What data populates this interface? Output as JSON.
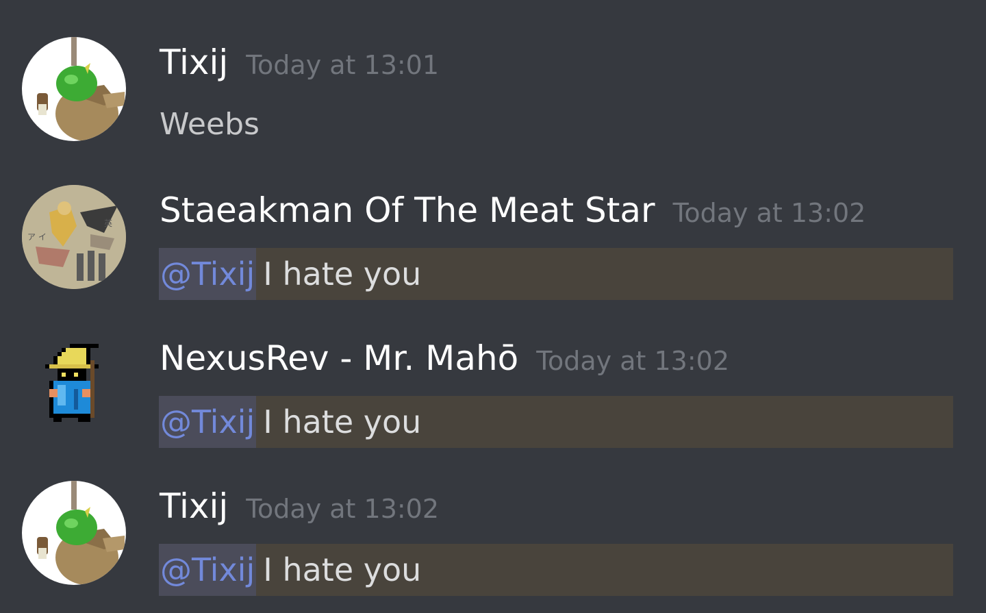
{
  "messages": [
    {
      "author": "Tixij",
      "timestamp": "Today at 13:01",
      "text": "Weebs",
      "avatar_icon": "moogle-avatar-icon"
    },
    {
      "author": "Staeakman Of The Meat Star",
      "timestamp": "Today at 13:02",
      "mention": "@Tixij",
      "text": "I hate you",
      "avatar_icon": "woodblock-print-avatar-icon"
    },
    {
      "author": "NexusRev - Mr. Mahō",
      "timestamp": "Today at 13:02",
      "mention": "@Tixij",
      "text": "I hate you",
      "avatar_icon": "black-mage-avatar-icon"
    },
    {
      "author": "Tixij",
      "timestamp": "Today at 13:02",
      "mention": "@Tixij",
      "text": "I hate you",
      "avatar_icon": "moogle-avatar-icon"
    }
  ],
  "colors": {
    "background": "#36393f",
    "username": "#ffffff",
    "timestamp": "#72767d",
    "mention_text": "#7289da",
    "mention_highlight": "#49443c"
  }
}
